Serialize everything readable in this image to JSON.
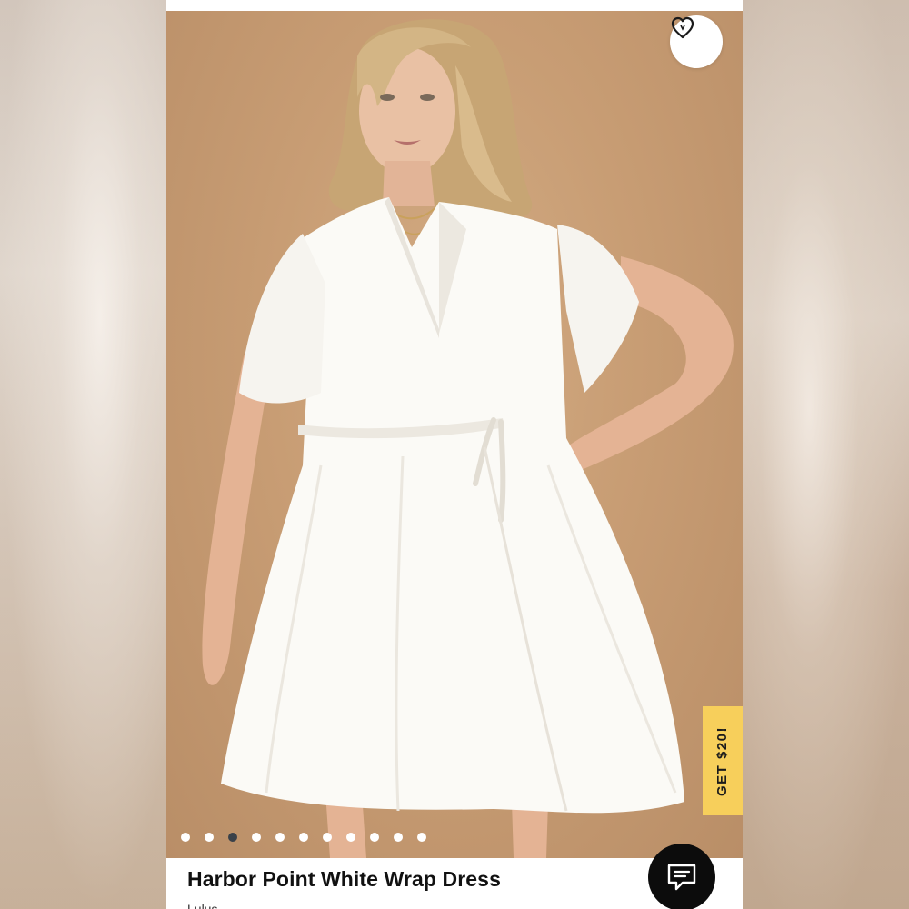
{
  "product": {
    "title": "Harbor Point White Wrap Dress",
    "brand": "Lulus"
  },
  "promo": {
    "label": "GET $20!"
  },
  "gallery": {
    "image_count": 11,
    "active_index": 2
  },
  "icons": {
    "wishlist": "heart-outline-icon",
    "chat": "chat-bubble-icon"
  },
  "colors": {
    "promo_background": "#f7cf5b",
    "photo_backdrop": "#c89d74",
    "chat_button": "#0c0c0c",
    "dot_active": "#3a4149",
    "dot_inactive": "#ffffff"
  }
}
